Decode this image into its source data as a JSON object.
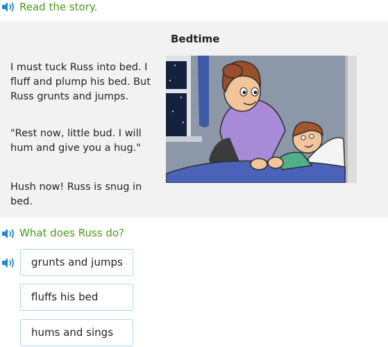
{
  "instruction": {
    "text": "Read the story."
  },
  "story": {
    "title": "Bedtime",
    "paragraphs": [
      "I must tuck Russ into bed. I fluff and plump his bed. But Russ grunts and jumps.",
      "\"Rest now, little bud. I will hum and give you a hug.\"",
      "Hush now! Russ is snug in bed."
    ],
    "illustration": "mother-tucking-child-into-bed"
  },
  "question": {
    "text": "What does Russ do?"
  },
  "choices": [
    {
      "label": "grunts and jumps"
    },
    {
      "label": "fluffs his bed"
    },
    {
      "label": "hums and sings"
    }
  ],
  "icons": {
    "audio": "speaker-icon"
  },
  "colors": {
    "accent_green": "#4a9a1e",
    "speaker_blue": "#1f88d4",
    "choice_border": "#a9d9ef",
    "panel_bg": "#f2f2f2"
  }
}
